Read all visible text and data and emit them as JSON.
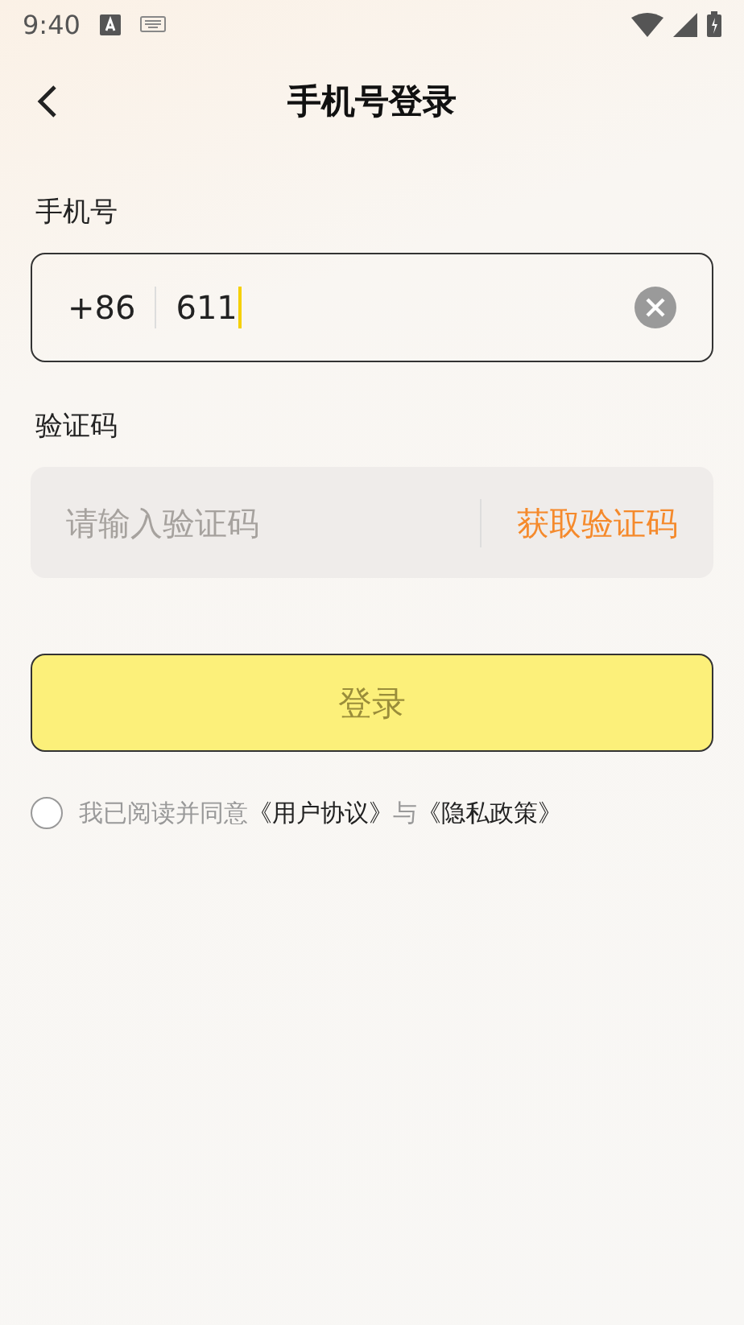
{
  "status_bar": {
    "time": "9:40"
  },
  "header": {
    "title": "手机号登录"
  },
  "phone": {
    "label": "手机号",
    "country_code": "+86",
    "value": "611",
    "focused": true
  },
  "code": {
    "label": "验证码",
    "placeholder": "请输入验证码",
    "action": "获取验证码"
  },
  "login_button": {
    "label": "登录",
    "disabled": true
  },
  "agreement": {
    "checked": false,
    "parts": [
      {
        "kind": "text",
        "text": "我已阅读并同意"
      },
      {
        "kind": "link",
        "text": "《用户协议》"
      },
      {
        "kind": "text",
        "text": "与"
      },
      {
        "kind": "link",
        "text": "《隐私政策》"
      }
    ]
  }
}
